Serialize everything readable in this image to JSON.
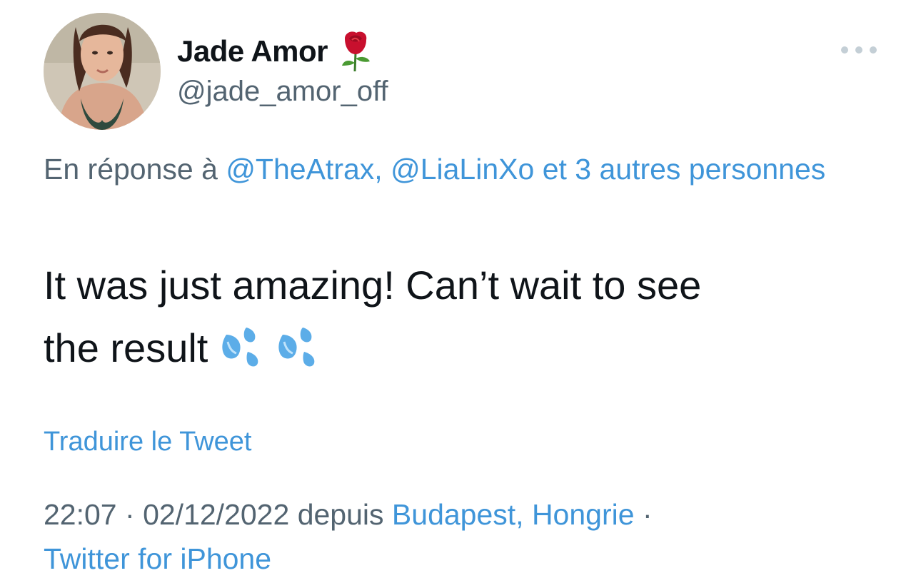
{
  "tweet": {
    "author": {
      "display_name": "Jade Amor",
      "handle": "@jade_amor_off",
      "name_emoji": "rose-icon"
    },
    "reply": {
      "prefix": "En réponse à",
      "users": [
        "@TheAtrax,",
        "@LiaLinXo"
      ],
      "others": "et 3 autres personnes"
    },
    "text": {
      "line1": "It was just amazing! Can’t wait to see",
      "line2": "the result",
      "emojis": [
        "sweat-droplets-icon",
        "sweat-droplets-icon"
      ]
    },
    "translate_label": "Traduire le Tweet",
    "meta": {
      "time": "22:07",
      "separator": "·",
      "date": "02/12/2022",
      "from": "depuis",
      "location": "Budapest, Hongrie",
      "separator2": "·",
      "source": "Twitter for iPhone"
    }
  },
  "colors": {
    "text_primary": "#0f1419",
    "text_secondary": "#536471",
    "link": "#3f95d9"
  }
}
